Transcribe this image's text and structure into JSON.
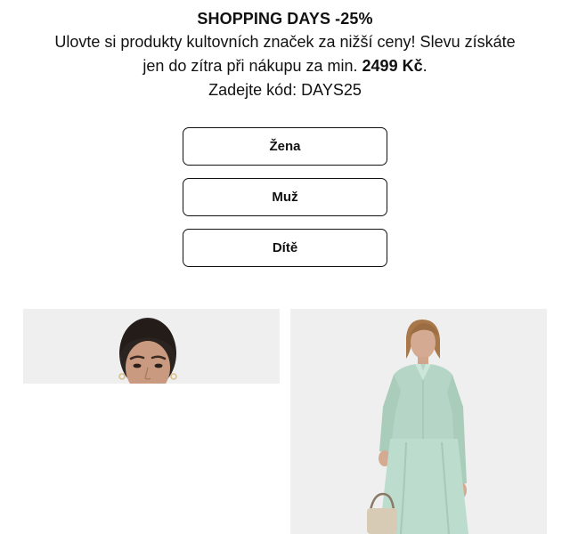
{
  "promo": {
    "title": "SHOPPING DAYS -25%",
    "line_1": "Ulovte si produkty kultovních značek za nižší ceny! Slevu získáte",
    "line_2_prefix": "jen do zítra při nákupu za min. ",
    "line_2_amount": "2499 Kč",
    "line_2_suffix": ".",
    "code_line": "Zadejte kód: DAYS25"
  },
  "navigation": {
    "buttons": [
      {
        "label": "Žena"
      },
      {
        "label": "Muž"
      },
      {
        "label": "Dítě"
      }
    ]
  },
  "product_tiles": [
    {
      "image": "woman-portrait-photo",
      "background": "#efefef"
    },
    {
      "image": "woman-mint-outfit-photo",
      "background": "#efefef",
      "outfit_color": "#b5d6c6"
    }
  ],
  "colors": {
    "text": "#111111",
    "button_border": "#111111",
    "tile_background": "#efefef"
  }
}
